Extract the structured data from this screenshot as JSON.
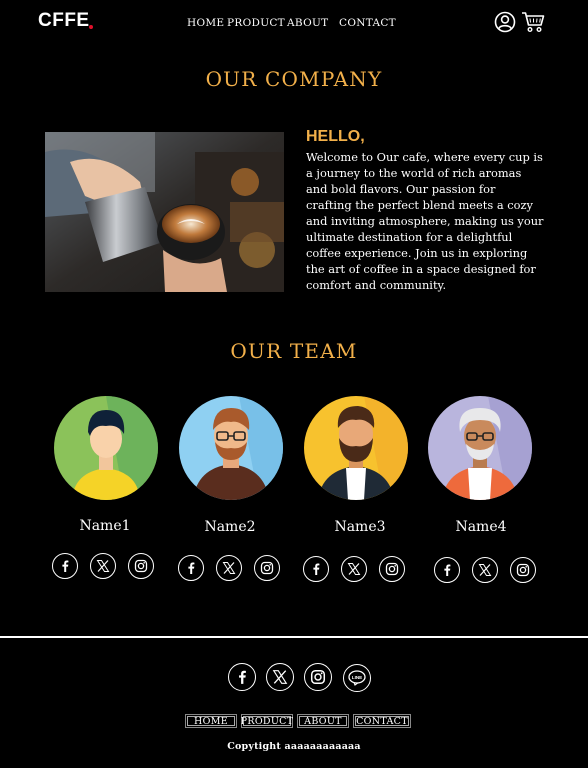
{
  "header": {
    "logo": "CFFE",
    "nav": [
      "HOME",
      "PRODUCT",
      "ABOUT",
      "CONTACT"
    ],
    "icons": [
      "user-icon",
      "cart-icon"
    ]
  },
  "company": {
    "heading": "OUR COMPANY",
    "hello": "HELLO,",
    "text": "Welcome to Our cafe, where every cup is a journey to the world of rich aromas and bold flavors. Our passion for crafting the perfect blend meets a cozy and inviting atmosphere, making us your ultimate destination for a delightful coffee experience. Join us in exploring the art of coffee in a space designed for comfort and community."
  },
  "team": {
    "heading": "OUR TEAM",
    "members": [
      {
        "name": "Name1",
        "bg": "#8bc25a"
      },
      {
        "name": "Name2",
        "bg": "#8fd0f2"
      },
      {
        "name": "Name3",
        "bg": "#f7c22e"
      },
      {
        "name": "Name4",
        "bg": "#b9b5dd"
      }
    ],
    "social_icons": [
      "facebook-icon",
      "x-icon",
      "instagram-icon"
    ]
  },
  "footer": {
    "social_icons": [
      "facebook-icon",
      "x-icon",
      "instagram-icon",
      "line-icon"
    ],
    "line_label": "LINE",
    "links": [
      "HOME",
      "PRODUCT",
      "ABOUT",
      "CONTACT"
    ],
    "copyright": "Copytight aaaaaaaaaaaa"
  },
  "colors": {
    "background": "#000000",
    "accent": "#f2b04a",
    "logo_dot": "#e0102a",
    "text": "#ffffff"
  }
}
